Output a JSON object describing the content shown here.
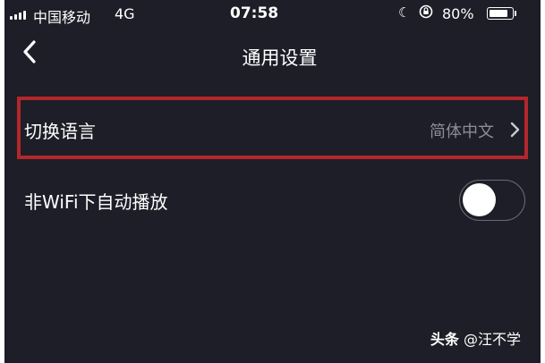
{
  "status_bar": {
    "carrier": "中国移动",
    "network": "4G",
    "time": "07:58",
    "battery": "80%",
    "icons": [
      "signal-icon",
      "moon-icon",
      "rotation-lock-icon",
      "battery-icon"
    ]
  },
  "nav": {
    "title": "通用设置",
    "back_icon": "chevron-left-icon"
  },
  "settings": [
    {
      "label": "切换语言",
      "value": "简体中文",
      "icon": "chevron-right-icon"
    },
    {
      "label": "非WiFi下自动播放",
      "toggle_on": false
    }
  ],
  "colors": {
    "background": "#1d1e27",
    "text": "#ffffff",
    "secondary_text": "#8c8d96",
    "highlight_border": "#b3272b"
  },
  "watermark": {
    "brand": "头条",
    "handle": "@汪不学"
  }
}
